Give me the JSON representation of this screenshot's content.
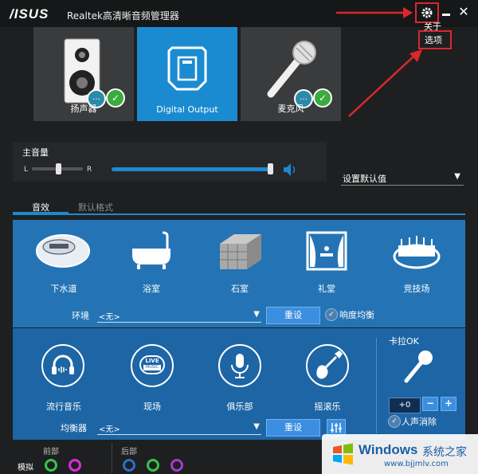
{
  "titlebar": {
    "logo": "/ISUS",
    "title": "Realtek高清晰音频管理器",
    "icons": [
      "gear-icon",
      "minimize-icon",
      "close-icon"
    ]
  },
  "settings_menu": {
    "items": [
      "关于",
      "选项"
    ]
  },
  "devices": [
    {
      "label": "扬声器",
      "icon": "speaker-icon",
      "active": false
    },
    {
      "label": "Digital Output",
      "icon": "digital-output-icon",
      "active": true
    },
    {
      "label": "麦克风",
      "icon": "microphone-icon",
      "active": false
    }
  ],
  "volume": {
    "label": "主音量",
    "balance_left": "L",
    "balance_right": "R",
    "level_percent": 100,
    "balance": 0.5
  },
  "default_select": {
    "label": "设置默认值"
  },
  "tabs": [
    "音效",
    "默认格式"
  ],
  "environment": {
    "items": [
      "下水道",
      "浴室",
      "石室",
      "礼堂",
      "竞技场"
    ],
    "label": "环境",
    "value": "<无>",
    "reset": "重设",
    "loudness": "响度均衡"
  },
  "equalizer": {
    "items": [
      "流行音乐",
      "现场",
      "俱乐部",
      "摇滚乐"
    ],
    "live_badge_top": "LIVE",
    "live_badge_bottom": "MUSIC",
    "label": "均衡器",
    "value": "<无>",
    "reset": "重设"
  },
  "karaoke": {
    "label": "卡拉OK",
    "value": "+0",
    "minus": "−",
    "plus": "+",
    "vocal_cancel": "人声消除"
  },
  "bottom": {
    "front": "前部",
    "rear": "后部",
    "analog": "模拟"
  },
  "watermark": {
    "brand": "Windows",
    "suffix": "系统之家",
    "url": "www.bjjmlv.com"
  },
  "colors": {
    "accent": "#1b8bd1",
    "env_panel": "#2474b5",
    "eq_panel": "#1d65a5",
    "highlight": "#d9282d"
  }
}
